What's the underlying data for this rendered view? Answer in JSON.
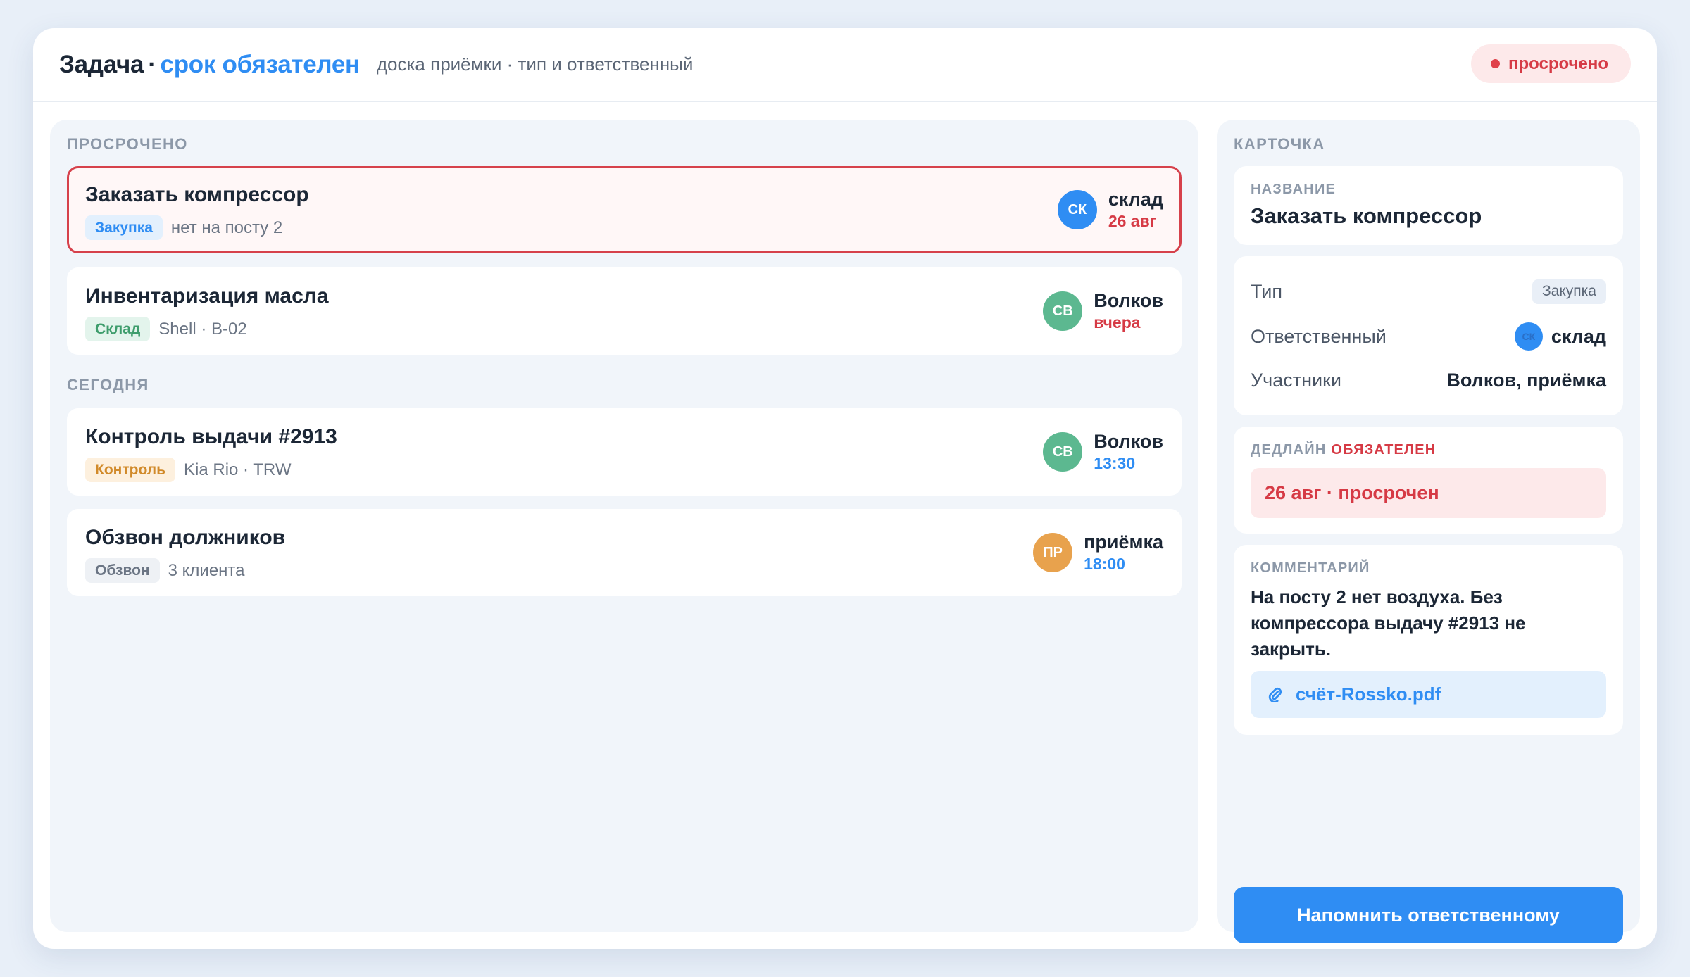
{
  "header": {
    "title_main": "Задача",
    "title_sep": "·",
    "title_accent": "срок обязателен",
    "subtitle": "доска приёмки · тип и ответственный",
    "status": "просрочено"
  },
  "board": {
    "sections": [
      {
        "label": "ПРОСРОЧЕНО",
        "tasks": [
          {
            "title": "Заказать компрессор",
            "tag": "Закупка",
            "meta": "нет на посту 2",
            "avatar": "СК",
            "assignee": "склад",
            "date": "26 авг"
          },
          {
            "title": "Инвентаризация масла",
            "tag": "Склад",
            "meta": "Shell · B-02",
            "avatar": "СВ",
            "assignee": "Волков",
            "date": "вчера"
          }
        ]
      },
      {
        "label": "СЕГОДНЯ",
        "tasks": [
          {
            "title": "Контроль выдачи #2913",
            "tag": "Контроль",
            "meta": "Kia Rio · TRW",
            "avatar": "СВ",
            "assignee": "Волков",
            "date": "13:30"
          },
          {
            "title": "Обзвон должников",
            "tag": "Обзвон",
            "meta": "3 клиента",
            "avatar": "ПР",
            "assignee": "приёмка",
            "date": "18:00"
          }
        ]
      }
    ]
  },
  "card": {
    "panel_label": "КАРТОЧКА",
    "name_label": "НАЗВАНИЕ",
    "name_value": "Заказать компрессор",
    "type_label": "Тип",
    "type_value": "Закупка",
    "owner_label": "Ответственный",
    "owner_avatar": "СК",
    "owner_value": "склад",
    "participants_label": "Участники",
    "participants_value": "Волков, приёмка",
    "deadline_label": "ДЕДЛАЙН",
    "deadline_flag": "ОБЯЗАТЕЛЕН",
    "deadline_value": "26 авг · просрочен",
    "comment_label": "КОММЕНТАРИЙ",
    "comment_text": "На посту 2 нет воздуха. Без компрессора выдачу #2913 не закрыть.",
    "attachment": "счёт-Rossko.pdf",
    "remind_button": "Напомнить ответственному"
  },
  "colors": {
    "accent": "#2f8df3",
    "danger": "#d63a45",
    "success": "#5cb890",
    "warning": "#e8a24d"
  },
  "icons": {
    "status": "dot-icon",
    "attachment": "paperclip-icon"
  }
}
